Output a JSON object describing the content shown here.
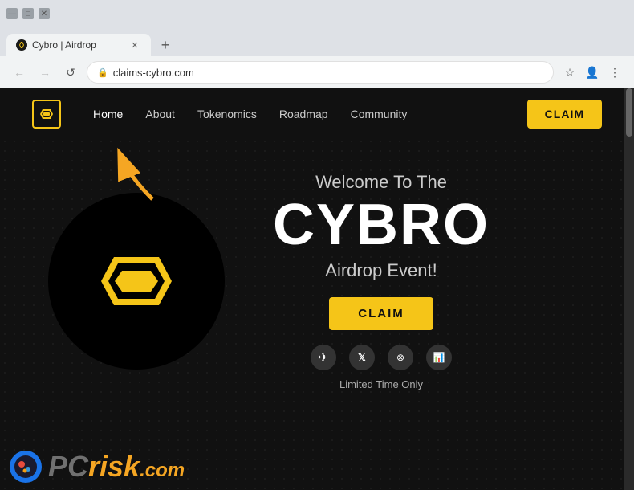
{
  "browser": {
    "tab_title": "Cybro | Airdrop",
    "url": "claims-cybro.com",
    "new_tab_label": "+",
    "nav": {
      "back_label": "←",
      "forward_label": "→",
      "reload_label": "↺"
    },
    "toolbar": {
      "bookmark_label": "☆",
      "profile_label": "👤",
      "menu_label": "⋮"
    }
  },
  "navbar": {
    "links": [
      {
        "label": "Home",
        "active": true
      },
      {
        "label": "About",
        "active": false
      },
      {
        "label": "Tokenomics",
        "active": false
      },
      {
        "label": "Roadmap",
        "active": false
      },
      {
        "label": "Community",
        "active": false
      }
    ],
    "claim_button": "CLAIM"
  },
  "hero": {
    "welcome": "Welcome To The",
    "title": "CYBRO",
    "subtitle": "Airdrop Event!",
    "claim_button": "CLAIM",
    "limited_text": "Limited Time Only"
  },
  "social_icons": [
    {
      "name": "telegram",
      "symbol": "✈"
    },
    {
      "name": "twitter",
      "symbol": "𝕏"
    },
    {
      "name": "discord",
      "symbol": "⊘"
    },
    {
      "name": "chart",
      "symbol": "📊"
    }
  ],
  "watermark": {
    "site": "pcrisk.com",
    "pc_text": "P",
    "risk_text": "risk",
    "com_text": ".com"
  },
  "colors": {
    "accent": "#f5c518",
    "bg": "#111111",
    "text_primary": "#ffffff",
    "text_secondary": "#cccccc"
  }
}
